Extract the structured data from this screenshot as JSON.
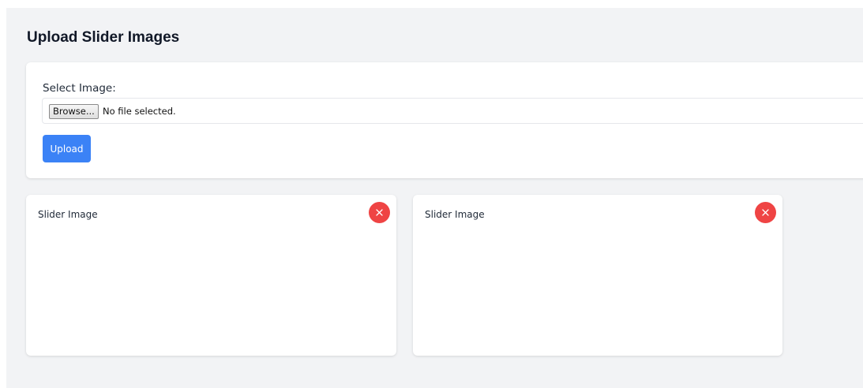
{
  "page": {
    "title": "Upload Slider Images"
  },
  "upload_form": {
    "select_label": "Select Image:",
    "browse_label": "Browse...",
    "file_status": "No file selected.",
    "upload_label": "Upload"
  },
  "slider_images": [
    {
      "label": "Slider Image",
      "delete_icon": "close-icon"
    },
    {
      "label": "Slider Image",
      "delete_icon": "close-icon"
    }
  ],
  "colors": {
    "accent": "#3b82f6",
    "danger": "#ef4444",
    "background": "#f2f3f5"
  }
}
